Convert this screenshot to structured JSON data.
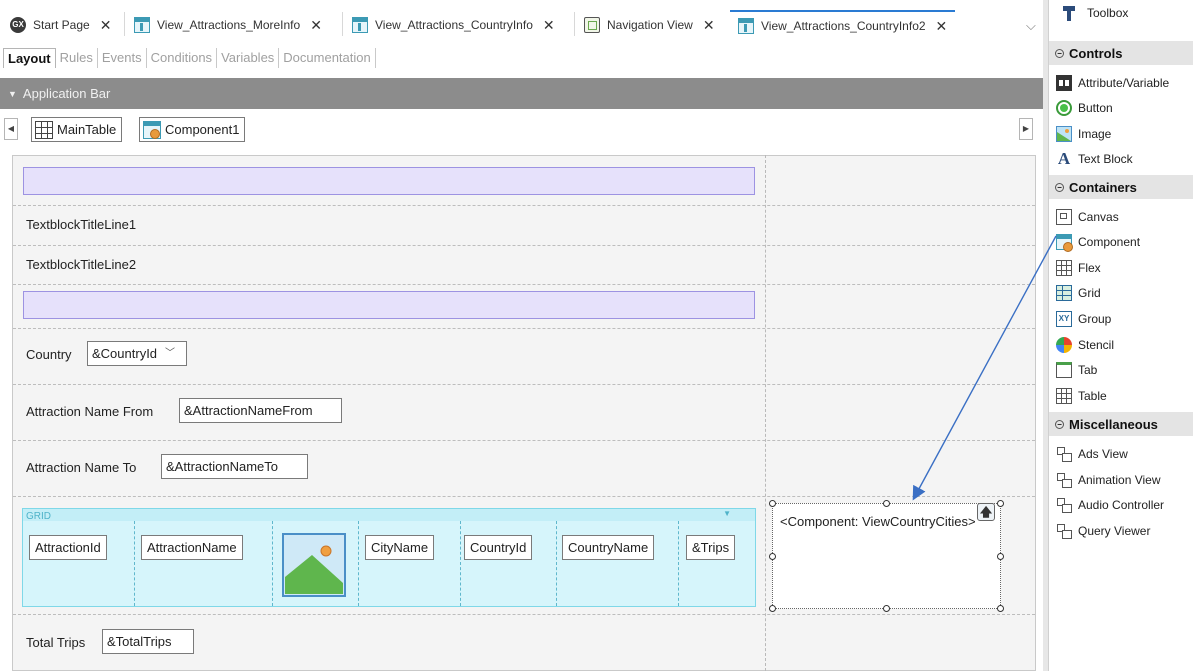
{
  "tabs": [
    {
      "label": "Start Page",
      "icon": "genexus-logo-icon",
      "active": false
    },
    {
      "label": "View_Attractions_MoreInfo",
      "icon": "panel-object-icon",
      "active": false
    },
    {
      "label": "View_Attractions_CountryInfo",
      "icon": "panel-object-icon",
      "active": false
    },
    {
      "label": "Navigation View",
      "icon": "navigation-view-icon",
      "active": false
    },
    {
      "label": "View_Attractions_CountryInfo2",
      "icon": "panel-object-icon",
      "active": true
    }
  ],
  "tab_close": "✕",
  "logo_text": "GX",
  "tab_overflow": "⌵",
  "subtabs": [
    "Layout",
    "Rules",
    "Events",
    "Conditions",
    "Variables",
    "Documentation"
  ],
  "appbar": {
    "label": "Application Bar",
    "caret": "▼"
  },
  "breadcrumb": {
    "left": "◀",
    "right": "▶",
    "items": [
      "MainTable",
      "Component1"
    ]
  },
  "form": {
    "title_line1": "TextblockTitleLine1",
    "title_line2": "TextblockTitleLine2",
    "country_label": "Country",
    "country_value": "&CountryId",
    "country_dropdown": "﹀",
    "name_from_label": "Attraction Name From",
    "name_from_value": "&AttractionNameFrom",
    "name_to_label": "Attraction Name To",
    "name_to_value": "&AttractionNameTo",
    "total_label": "Total Trips",
    "total_value": "&TotalTrips"
  },
  "grid": {
    "label": "GRID",
    "caret": "▼",
    "columns": [
      "AttractionId",
      "AttractionName",
      "CityName",
      "CountryId",
      "CountryName",
      "&Trips"
    ]
  },
  "component_placeholder": {
    "text": "<Component: ViewCountryCities>",
    "up": "🡅"
  },
  "toolbox": {
    "title": "Toolbox",
    "sections": [
      {
        "name": "Controls",
        "items": [
          "Attribute/Variable",
          "Button",
          "Image",
          "Text Block"
        ]
      },
      {
        "name": "Containers",
        "items": [
          "Canvas",
          "Component",
          "Flex",
          "Grid",
          "Group",
          "Stencil",
          "Tab",
          "Table"
        ]
      },
      {
        "name": "Miscellaneous",
        "items": [
          "Ads View",
          "Animation View",
          "Audio Controller",
          "Query Viewer"
        ]
      }
    ],
    "collapse_glyph": "−",
    "group_icon_text": "XY",
    "text_icon_text": "A"
  },
  "colors": {
    "accent": "#2a7bd3",
    "grid_bg": "#d6f5fb",
    "placeholder": "#e6e1fb",
    "appbar": "#8c8c8c",
    "arrow": "#3a6fc4"
  }
}
